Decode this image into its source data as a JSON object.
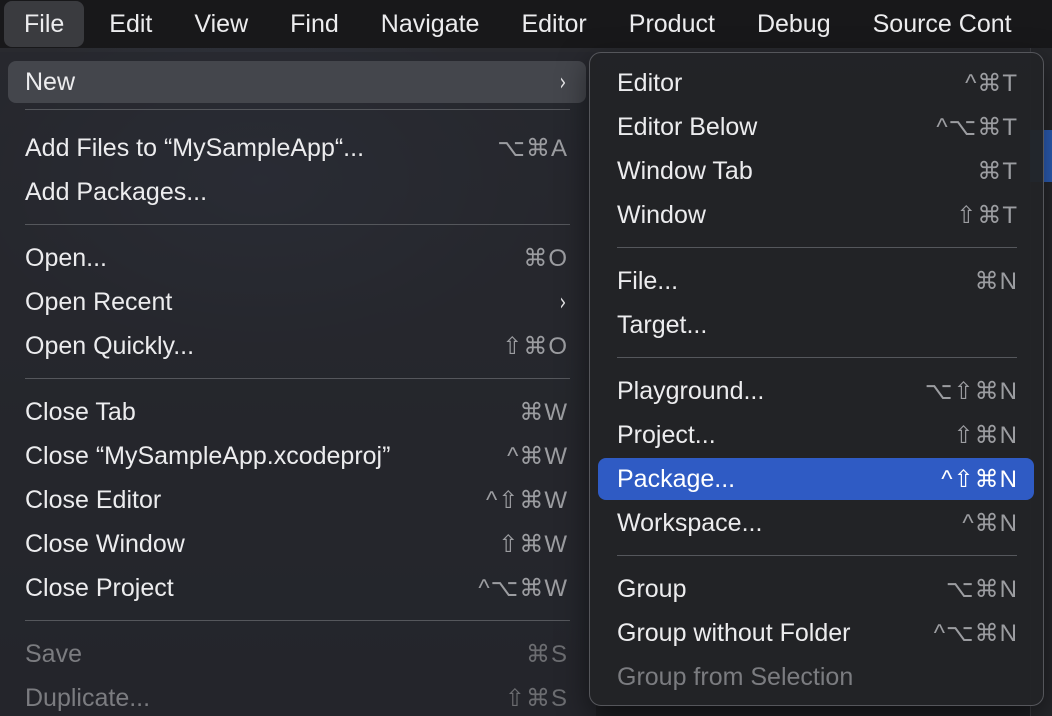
{
  "menubar": {
    "items": [
      "File",
      "Edit",
      "View",
      "Find",
      "Navigate",
      "Editor",
      "Product",
      "Debug",
      "Source Cont"
    ]
  },
  "file_menu": {
    "items": [
      {
        "label": "New",
        "shortcut": "",
        "submenu": true
      },
      {
        "label": "Add Files to “MySampleApp“...",
        "shortcut": "⌥⌘A"
      },
      {
        "label": "Add Packages...",
        "shortcut": ""
      },
      {
        "label": "Open...",
        "shortcut": "⌘O"
      },
      {
        "label": "Open Recent",
        "shortcut": "",
        "submenu": true
      },
      {
        "label": "Open Quickly...",
        "shortcut": "⇧⌘O"
      },
      {
        "label": "Close Tab",
        "shortcut": "⌘W"
      },
      {
        "label": "Close “MySampleApp.xcodeproj”",
        "shortcut": "^⌘W"
      },
      {
        "label": "Close Editor",
        "shortcut": "^⇧⌘W"
      },
      {
        "label": "Close Window",
        "shortcut": "⇧⌘W"
      },
      {
        "label": "Close Project",
        "shortcut": "^⌥⌘W"
      },
      {
        "label": "Save",
        "shortcut": "⌘S",
        "disabled": true
      },
      {
        "label": "Duplicate...",
        "shortcut": "⇧⌘S",
        "disabled": true
      }
    ],
    "chevron": "›"
  },
  "new_submenu": {
    "items": [
      {
        "label": "Editor",
        "shortcut": "^⌘T"
      },
      {
        "label": "Editor Below",
        "shortcut": "^⌥⌘T"
      },
      {
        "label": "Window Tab",
        "shortcut": "⌘T"
      },
      {
        "label": "Window",
        "shortcut": "⇧⌘T"
      },
      {
        "label": "File...",
        "shortcut": "⌘N"
      },
      {
        "label": "Target...",
        "shortcut": ""
      },
      {
        "label": "Playground...",
        "shortcut": "⌥⇧⌘N"
      },
      {
        "label": "Project...",
        "shortcut": "⇧⌘N"
      },
      {
        "label": "Package...",
        "shortcut": "^⇧⌘N",
        "selected": true
      },
      {
        "label": "Workspace...",
        "shortcut": "^⌘N"
      },
      {
        "label": "Group",
        "shortcut": "⌥⌘N"
      },
      {
        "label": "Group without Folder",
        "shortcut": "^⌥⌘N"
      },
      {
        "label": "Group from Selection",
        "shortcut": "",
        "disabled": true
      }
    ]
  }
}
